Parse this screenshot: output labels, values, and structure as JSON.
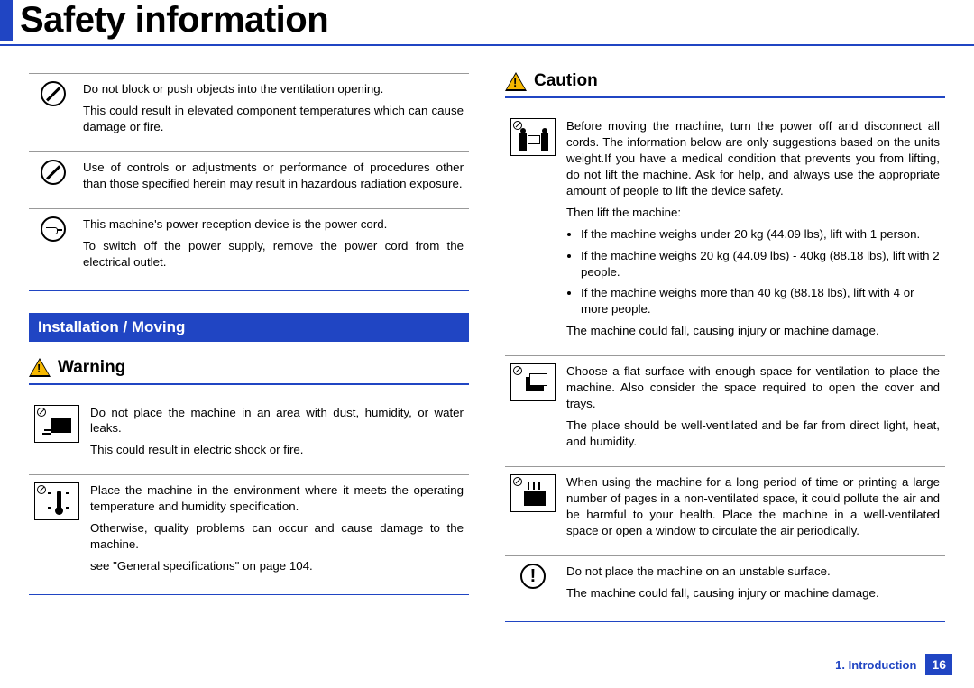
{
  "page_title": "Safety information",
  "section_heading": "Installation / Moving",
  "labels": {
    "warning": "Warning",
    "caution": "Caution"
  },
  "left_top_rows": [
    {
      "icon": "prohibit",
      "paras": [
        "Do not block or push objects into the ventilation opening.",
        "This could result in elevated component temperatures which can cause damage or fire."
      ]
    },
    {
      "icon": "prohibit",
      "paras": [
        "Use of controls or adjustments or performance of procedures other than those specified herein may result in hazardous radiation exposure."
      ]
    },
    {
      "icon": "plug",
      "paras": [
        "This machine's power reception device is the power cord.",
        "To switch off the power supply, remove the power cord from the electrical outlet."
      ]
    }
  ],
  "warning_rows": [
    {
      "icon": "picto-dust",
      "paras": [
        "Do not place the machine in an area with dust, humidity, or water leaks.",
        "This could result in electric shock or fire."
      ]
    },
    {
      "icon": "picto-temp",
      "paras": [
        "Place the machine in the environment where it meets the operating temperature and humidity specification.",
        "Otherwise, quality problems can occur and cause damage to the machine.",
        "see \"General specifications\" on page 104."
      ]
    }
  ],
  "caution_rows": [
    {
      "icon": "picto-lift",
      "paras": [
        "Before moving the machine, turn the power off and disconnect all cords. The information below are only suggestions based on the units weight.If you have a medical condition that prevents you from lifting, do not lift the machine. Ask for help, and always use the appropriate amount of people to lift the device safety.",
        "Then lift the machine:"
      ],
      "bullets": [
        "If the machine weighs under 20 kg (44.09 lbs), lift with 1 person.",
        "If the machine weighs 20 kg (44.09 lbs) - 40kg (88.18 lbs), lift with 2 people.",
        "If the machine weighs more than 40 kg (88.18 lbs), lift with 4 or more people."
      ],
      "paras_after": [
        "The machine could fall, causing injury or machine damage."
      ]
    },
    {
      "icon": "picto-place",
      "paras": [
        "Choose a flat surface with enough space for ventilation to place the machine. Also consider the space required to open the cover and trays.",
        "The place should be well-ventilated and be far from direct light, heat, and humidity."
      ]
    },
    {
      "icon": "picto-heat",
      "paras": [
        "When using the machine for a long period of time or printing a large number of pages in a non-ventilated space, it could pollute the air and be harmful to your health. Place the machine in a well-ventilated space or open a window to circulate the air periodically."
      ]
    },
    {
      "icon": "excl",
      "paras": [
        "Do not place the machine on an unstable surface.",
        "The machine could fall, causing injury or machine damage."
      ]
    }
  ],
  "footer": {
    "chapter": "1. Introduction",
    "page": "16"
  }
}
